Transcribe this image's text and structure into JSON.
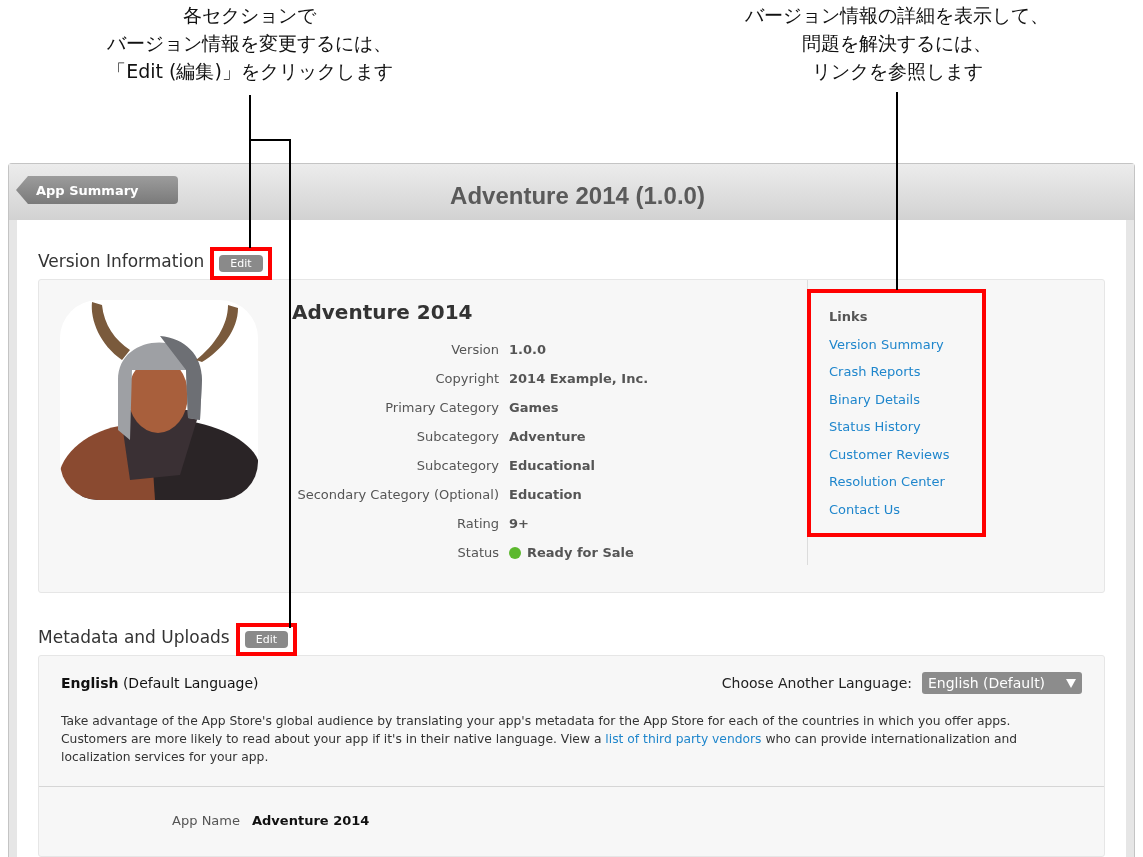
{
  "callouts": [
    {
      "lines": [
        "各セクションで",
        "バージョン情報を変更するには、",
        "「Edit (編集)」をクリックします"
      ]
    },
    {
      "lines": [
        "バージョン情報の詳細を表示して、",
        "問題を解決するには、",
        "リンクを参照します"
      ]
    }
  ],
  "header": {
    "back_button": "App Summary",
    "title": "Adventure 2014 (1.0.0)"
  },
  "version_information": {
    "heading": "Version Information",
    "edit_button": "Edit",
    "highlighted": true,
    "app_title": "Adventure 2014",
    "details": [
      {
        "label": "Version",
        "value": "1.0.0"
      },
      {
        "label": "Copyright",
        "value": "2014 Example, Inc."
      },
      {
        "label": "Primary Category",
        "value": "Games"
      },
      {
        "label": "Subcategory",
        "value": "Adventure"
      },
      {
        "label": "Subcategory",
        "value": "Educational"
      },
      {
        "label": "Secondary Category (Optional)",
        "value": "Education"
      },
      {
        "label": "Rating",
        "value": "9+"
      }
    ],
    "status": {
      "label": "Status",
      "value": "Ready for Sale",
      "color": "#5cb82e"
    },
    "links": {
      "heading": "Links",
      "highlighted": true,
      "items": [
        "Version Summary",
        "Crash Reports",
        "Binary Details",
        "Status History",
        "Customer Reviews",
        "Resolution Center",
        "Contact Us"
      ]
    }
  },
  "metadata_and_uploads": {
    "heading": "Metadata and Uploads",
    "edit_button": "Edit",
    "highlighted": true,
    "language": "English",
    "language_note": "(Default Language)",
    "choose_label": "Choose Another Language:",
    "language_select": "English (Default)",
    "description": "Take advantage of the App Store's global audience by translating your app's metadata for the App Store for each of the countries in which you offer apps. Customers are more likely to read about your app if it's in their native language. View a ",
    "description_link": "list of third party vendors",
    "description_end": " who can provide internationalization and localization services for your app.",
    "fields": [
      {
        "label": "App Name",
        "value": "Adventure 2014"
      }
    ]
  }
}
